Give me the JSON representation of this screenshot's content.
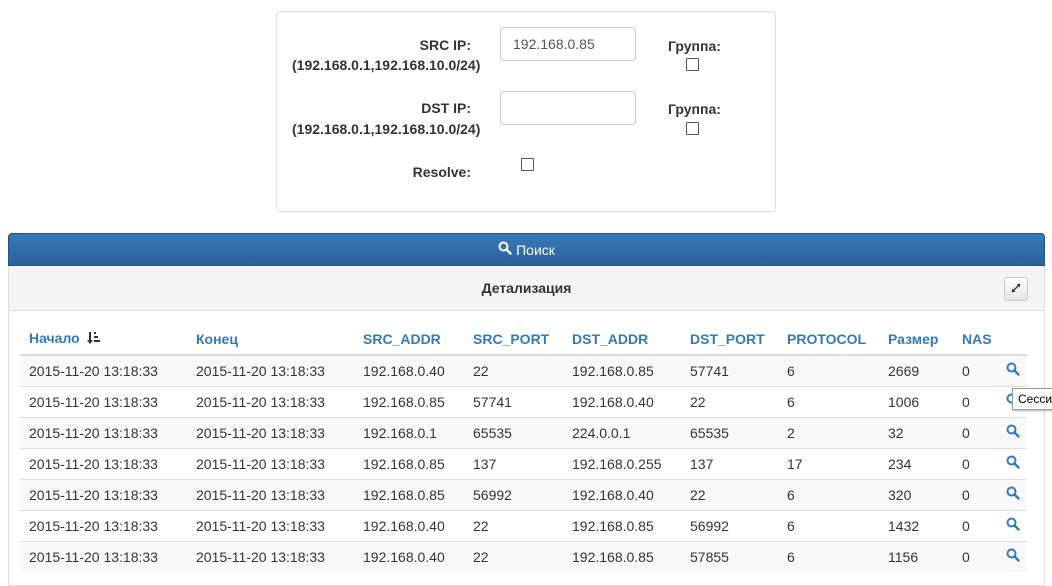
{
  "form": {
    "src_ip": {
      "label": "SRC IP:",
      "hint": "(192.168.0.1,192.168.10.0/24)",
      "value": "192.168.0.85",
      "group_label": "Группа:"
    },
    "dst_ip": {
      "label": "DST IP:",
      "hint": "(192.168.0.1,192.168.10.0/24)",
      "value": "",
      "group_label": "Группа:"
    },
    "resolve_label": "Resolve:"
  },
  "search_button": {
    "label": "Поиск",
    "icon": "search-icon"
  },
  "results": {
    "title": "Детализация",
    "collapse_icon": "compress-icon",
    "columns": [
      "Начало",
      "Конец",
      "SRC_ADDR",
      "SRC_PORT",
      "DST_ADDR",
      "DST_PORT",
      "PROTOCOL",
      "Размер",
      "NAS"
    ],
    "sort_icon": "sort-amount-desc-icon",
    "rows": [
      [
        "2015-11-20 13:18:33",
        "2015-11-20 13:18:33",
        "192.168.0.40",
        "22",
        "192.168.0.85",
        "57741",
        "6",
        "2669",
        "0"
      ],
      [
        "2015-11-20 13:18:33",
        "2015-11-20 13:18:33",
        "192.168.0.85",
        "57741",
        "192.168.0.40",
        "22",
        "6",
        "1006",
        "0"
      ],
      [
        "2015-11-20 13:18:33",
        "2015-11-20 13:18:33",
        "192.168.0.1",
        "65535",
        "224.0.0.1",
        "65535",
        "2",
        "32",
        "0"
      ],
      [
        "2015-11-20 13:18:33",
        "2015-11-20 13:18:33",
        "192.168.0.85",
        "137",
        "192.168.0.255",
        "137",
        "17",
        "234",
        "0"
      ],
      [
        "2015-11-20 13:18:33",
        "2015-11-20 13:18:33",
        "192.168.0.85",
        "56992",
        "192.168.0.40",
        "22",
        "6",
        "320",
        "0"
      ],
      [
        "2015-11-20 13:18:33",
        "2015-11-20 13:18:33",
        "192.168.0.40",
        "22",
        "192.168.0.85",
        "56992",
        "6",
        "1432",
        "0"
      ],
      [
        "2015-11-20 13:18:33",
        "2015-11-20 13:18:33",
        "192.168.0.40",
        "22",
        "192.168.0.85",
        "57855",
        "6",
        "1156",
        "0"
      ]
    ],
    "row_action_icon": "search-icon",
    "tooltip": "Сесси"
  },
  "colors": {
    "primary": "#337ab7",
    "button_bg": "#2f6eae",
    "panel_border": "#dddddd",
    "header_bg": "#f5f5f5"
  }
}
